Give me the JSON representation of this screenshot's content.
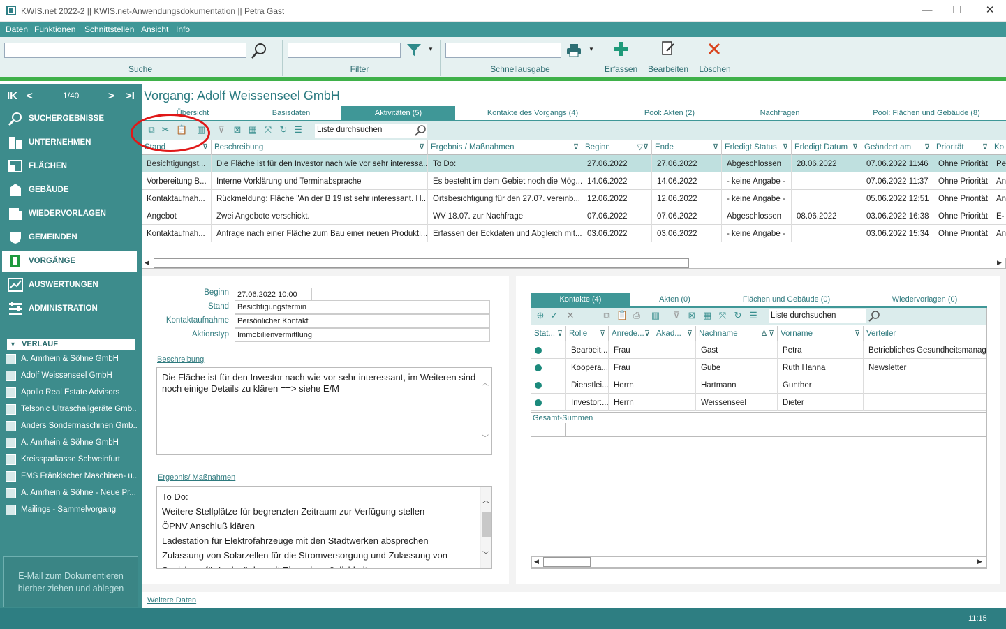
{
  "window": {
    "title": "KWIS.net 2022-2 || KWIS.net-Anwendungsdokumentation || Petra Gast",
    "minimize": "—",
    "maximize": "☐",
    "close": "✕"
  },
  "menu": [
    "Daten",
    "Funktionen",
    "Schnittstellen",
    "Ansicht",
    "Info"
  ],
  "toolbar": {
    "search_label": "Suche",
    "filter_label": "Filter",
    "quickprint_label": "Schnellausgabe",
    "create_label": "Erfassen",
    "edit_label": "Bearbeiten",
    "delete_label": "Löschen",
    "accent_green": "#3fb14a",
    "delete_red": "#d9441e"
  },
  "sidebar": {
    "first": "K",
    "prev": "<",
    "page": "1/40",
    "next": ">",
    "last": ">I",
    "nav": [
      {
        "label": "SUCHERGEBNISSE",
        "icon": "magnifier-icon"
      },
      {
        "label": "UNTERNEHMEN",
        "icon": "building-icon"
      },
      {
        "label": "FLÄCHEN",
        "icon": "area-icon"
      },
      {
        "label": "GEBÄUDE",
        "icon": "gebaeude-icon"
      },
      {
        "label": "WIEDERVORLAGEN",
        "icon": "resubmission-icon"
      },
      {
        "label": "GEMEINDEN",
        "icon": "crest-icon"
      },
      {
        "label": "VORGÄNGE",
        "icon": "folder-icon",
        "active": true
      },
      {
        "label": "AUSWERTUNGEN",
        "icon": "chart-icon"
      },
      {
        "label": "ADMINISTRATION",
        "icon": "admin-icon"
      }
    ],
    "history_title": "VERLAUF",
    "history": [
      "A. Amrhein & Söhne GmbH",
      "Adolf Weissenseel GmbH",
      "Apollo Real Estate Advisors",
      "Telsonic Ultraschallgeräte Gmb...",
      "Anders Sondermaschinen Gmb...",
      "A. Amrhein & Söhne GmbH",
      "Kreissparkasse Schweinfurt",
      "FMS Fränkischer Maschinen- u...",
      "A. Amrhein & Söhne - Neue Pr...",
      "Mailings - Sammelvorgang"
    ],
    "dropzone_line1": "E-Mail zum Dokumentieren",
    "dropzone_line2": "hierher ziehen und ablegen"
  },
  "main": {
    "title": "Vorgang: Adolf Weissenseel GmbH",
    "tabs": [
      "Übersicht",
      "Basisdaten",
      "Aktivitäten (5)",
      "Kontakte des Vorgangs (4)",
      "Pool: Akten (2)",
      "Nachfragen",
      "Pool: Flächen und Gebäude (8)"
    ],
    "active_tab": 2,
    "grid_search_placeholder": "Liste durchsuchen",
    "columns": [
      "Stand",
      "Beschreibung",
      "Ergebnis / Maßnahmen",
      "Beginn",
      "Ende",
      "Erledigt Status",
      "Erledigt Datum",
      "Geändert am",
      "Priorität",
      "Ko"
    ],
    "rows": [
      [
        "Besichtigungst...",
        "Die Fläche ist für den Investor nach wie vor sehr interessa...",
        "To Do:",
        "27.06.2022",
        "27.06.2022",
        "Abgeschlossen",
        "28.06.2022",
        "07.06.2022 11:46",
        "Ohne Priorität",
        "Pe"
      ],
      [
        "Vorbereitung B...",
        "Interne Vorklärung und Terminabsprache",
        "Es besteht im dem Gebiet noch die Mög...",
        "14.06.2022",
        "14.06.2022",
        "- keine Angabe -",
        "",
        "07.06.2022 11:37",
        "Ohne Priorität",
        "An"
      ],
      [
        "Kontaktaufnah...",
        "Rückmeldung: Fläche \"An der B 19 ist sehr interessant. H...",
        "Ortsbesichtigung für den 27.07. vereinb...",
        "12.06.2022",
        "12.06.2022",
        "- keine Angabe -",
        "",
        "05.06.2022 12:51",
        "Ohne Priorität",
        "An"
      ],
      [
        "Angebot",
        "Zwei Angebote verschickt.",
        "WV 18.07. zur Nachfrage",
        "07.06.2022",
        "07.06.2022",
        "Abgeschlossen",
        "08.06.2022",
        "03.06.2022 16:38",
        "Ohne Priorität",
        "E-"
      ],
      [
        "Kontaktaufnah...",
        "Anfrage nach einer Fläche zum Bau einer neuen Produkti...",
        "Erfassen der Eckdaten und Abgleich mit...",
        "03.06.2022",
        "03.06.2022",
        "- keine Angabe -",
        "",
        "03.06.2022 15:34",
        "Ohne Priorität",
        "An"
      ]
    ],
    "selected_row": 0
  },
  "detail": {
    "fields": [
      {
        "label": "Beginn",
        "value": "27.06.2022 10:00"
      },
      {
        "label": "Stand",
        "value": "Besichtigungstermin"
      },
      {
        "label": "Kontaktaufnahme",
        "value": "Persönlicher Kontakt"
      },
      {
        "label": "Aktionstyp",
        "value": "Immobilienvermittlung"
      }
    ],
    "beschreibung_label": "Beschreibung",
    "beschreibung_text": "Die Fläche ist für den Investor nach wie vor sehr interessant, im Weiteren sind noch einige Details zu klären ==> siehe E/M",
    "ergebnis_label": "Ergebnis/ Maßnahmen",
    "ergebnis_lines": [
      "To Do:",
      "Weitere Stellplätze für begrenzten Zeitraum zur Verfügung stellen",
      "ÖPNV Anschluß klären",
      "Ladestation für Elektrofahrzeuge mit den Stadtwerken absprechen",
      "Zulassung von Solarzellen für die Stromversorgung und Zulassung von",
      "Speichern für Ladesäulen mit Einspeisemöglichkeit"
    ],
    "weitere_daten": "Weitere Daten"
  },
  "contacts": {
    "tabs": [
      "Kontakte (4)",
      "Akten (0)",
      "Flächen und Gebäude (0)",
      "Wiedervorlagen (0)"
    ],
    "search_placeholder": "Liste durchsuchen",
    "columns": [
      "Stat...",
      "Rolle",
      "Anrede...",
      "Akad...",
      "Nachname",
      "Vorname",
      "Verteiler"
    ],
    "rows": [
      [
        "",
        "Bearbeit...",
        "Frau",
        "",
        "Gast",
        "Petra",
        "Betriebliches Gesundheitsmanage"
      ],
      [
        "",
        "Koopera...",
        "Frau",
        "",
        "Gube",
        "Ruth Hanna",
        "Newsletter"
      ],
      [
        "",
        "Dienstlei...",
        "Herrn",
        "",
        "Hartmann",
        "Gunther",
        ""
      ],
      [
        "",
        "Investor:...",
        "Herrn",
        "",
        "Weissenseel",
        "Dieter",
        ""
      ]
    ],
    "summary_label": "Gesamt-Summen"
  },
  "status": {
    "time": "11:15"
  }
}
